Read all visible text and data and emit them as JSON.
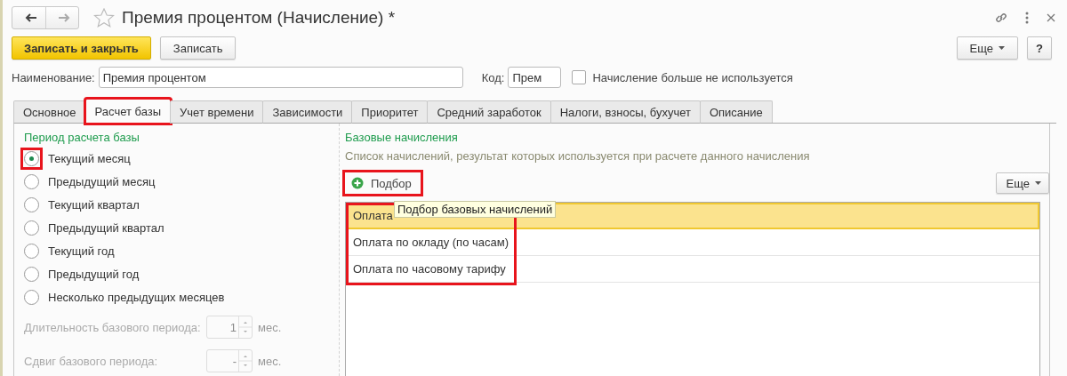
{
  "window": {
    "title": "Премия процентом (Начисление) *",
    "favorite": false
  },
  "toolbar": {
    "buttons": [
      {
        "label": "Записать и закрыть",
        "kind": "primary"
      },
      {
        "label": "Записать",
        "kind": "normal"
      }
    ],
    "more": "Еще",
    "help": "?"
  },
  "fields": {
    "name_label": "Наименование:",
    "name_value": "Премия процентом",
    "code_label": "Код:",
    "code_value": "Прем",
    "unused_label": "Начисление больше не используется",
    "unused_checked": false
  },
  "tabs": [
    {
      "label": "Основное",
      "selected": false,
      "highlighted": false
    },
    {
      "label": "Расчет базы",
      "selected": true,
      "highlighted": true
    },
    {
      "label": "Учет времени",
      "selected": false,
      "highlighted": false
    },
    {
      "label": "Зависимости",
      "selected": false,
      "highlighted": false
    },
    {
      "label": "Приоритет",
      "selected": false,
      "highlighted": false
    },
    {
      "label": "Средний заработок",
      "selected": false,
      "highlighted": false
    },
    {
      "label": "Налоги, взносы, бухучет",
      "selected": false,
      "highlighted": false
    },
    {
      "label": "Описание",
      "selected": false,
      "highlighted": false
    }
  ],
  "period": {
    "title": "Период расчета базы",
    "options": [
      {
        "label": "Текущий месяц",
        "selected": true,
        "highlighted": true
      },
      {
        "label": "Предыдущий месяц",
        "selected": false,
        "highlighted": false
      },
      {
        "label": "Текущий квартал",
        "selected": false,
        "highlighted": false
      },
      {
        "label": "Предыдущий квартал",
        "selected": false,
        "highlighted": false
      },
      {
        "label": "Текущий год",
        "selected": false,
        "highlighted": false
      },
      {
        "label": "Предыдущий год",
        "selected": false,
        "highlighted": false
      },
      {
        "label": "Несколько предыдущих месяцев",
        "selected": false,
        "highlighted": false
      }
    ],
    "spinners": [
      {
        "label": "Длительность базового периода:",
        "value": "1",
        "unit": "мес.",
        "disabled": true
      },
      {
        "label": "Сдвиг базового периода:",
        "value": "-",
        "unit": "мес.",
        "disabled": true
      }
    ]
  },
  "base": {
    "title": "Базовые начисления",
    "description": "Список начислений, результат которых используется при расчете данного начисления",
    "pick_button": {
      "label": "Подбор",
      "highlighted": true
    },
    "more": "Еще",
    "tooltip": "Подбор базовых начислений",
    "rows_highlighted": true,
    "rows": [
      {
        "name": "Оплата",
        "selected": true
      },
      {
        "name": "Оплата по окладу (по часам)",
        "selected": false
      },
      {
        "name": "Оплата по часовому тарифу",
        "selected": false
      }
    ]
  }
}
